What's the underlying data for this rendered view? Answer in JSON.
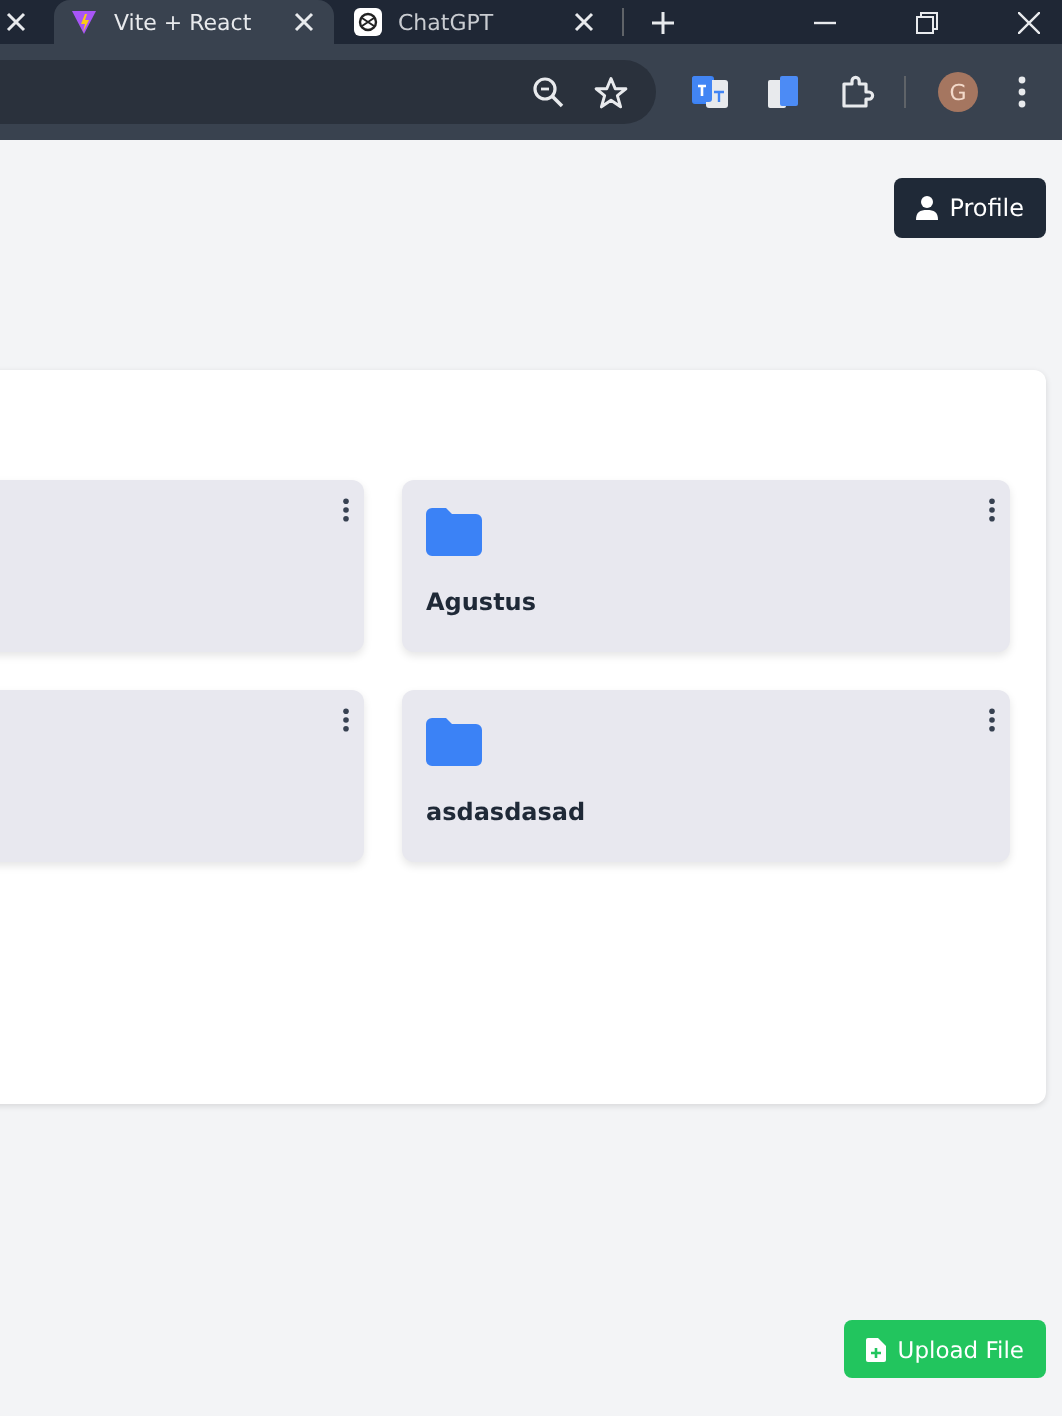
{
  "browser": {
    "tabs": [
      {
        "title": "Vite + React",
        "selected": true,
        "kind": "vite"
      },
      {
        "title": "ChatGPT",
        "selected": false,
        "kind": "chatgpt"
      }
    ],
    "avatar": "G"
  },
  "header": {
    "profile_button": "Profile"
  },
  "folders": [
    {
      "kind": "cut"
    },
    {
      "kind": "folder",
      "name": "Agustus"
    },
    {
      "kind": "cut"
    },
    {
      "kind": "folder",
      "name": "asdasdasad"
    }
  ],
  "upload_button": "Upload File"
}
